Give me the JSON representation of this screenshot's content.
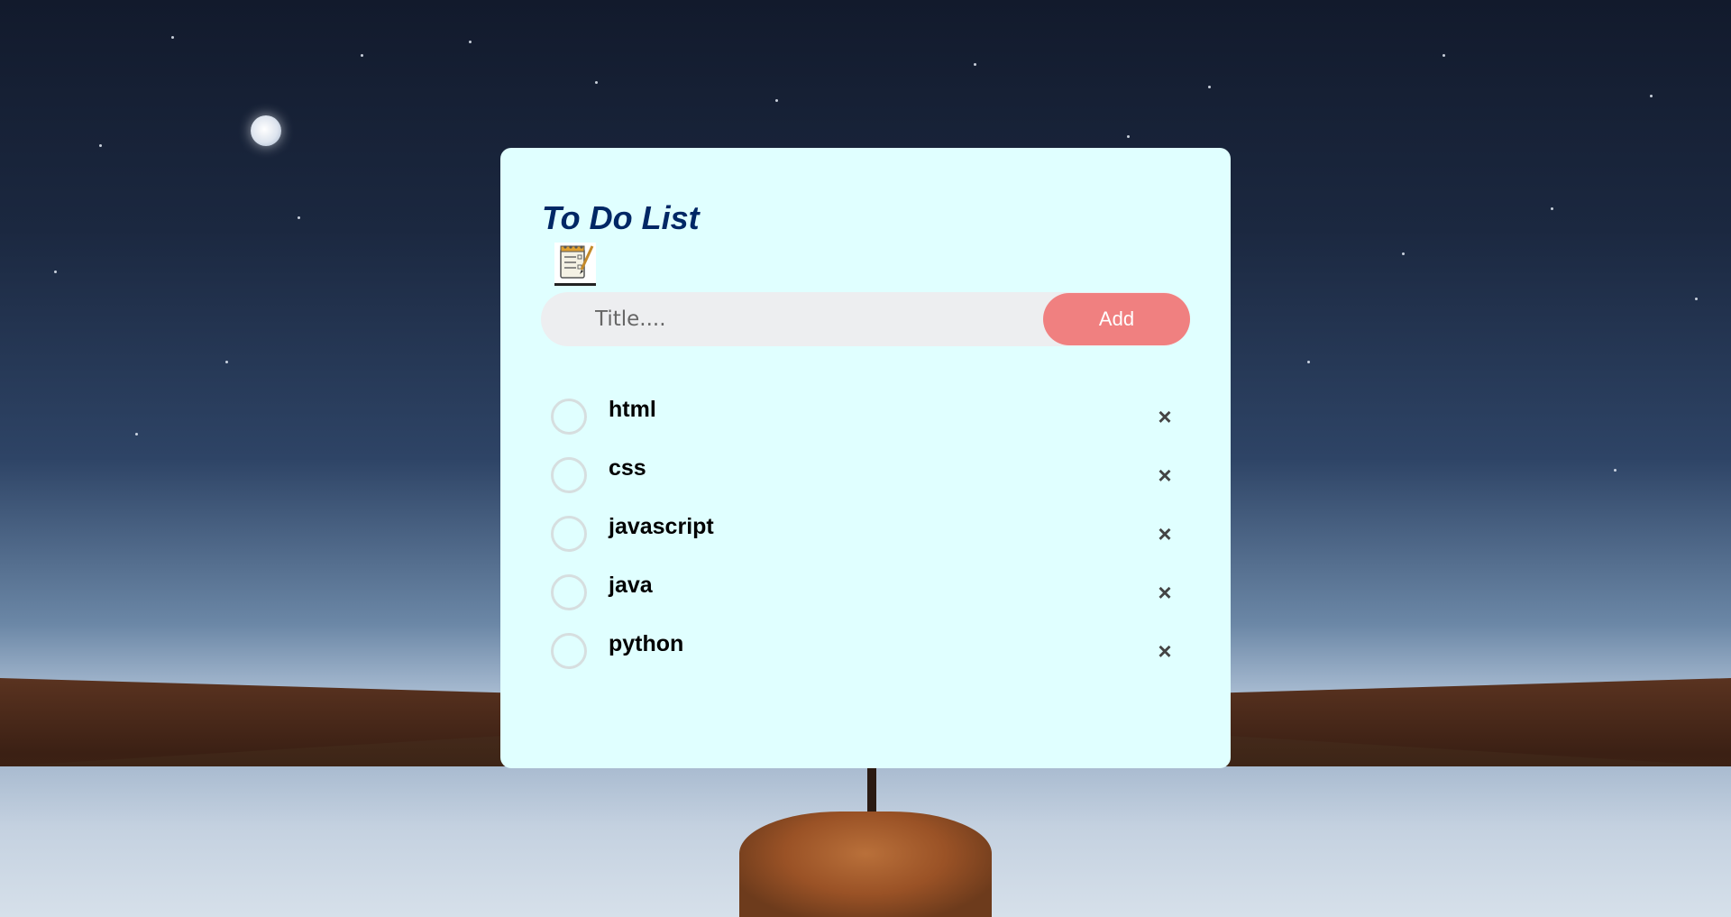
{
  "app": {
    "title": "To Do List"
  },
  "input": {
    "placeholder": "Title....",
    "value": ""
  },
  "add_button": {
    "label": "Add"
  },
  "tasks": [
    {
      "label": "html",
      "checked": false
    },
    {
      "label": "css",
      "checked": false
    },
    {
      "label": "javascript",
      "checked": false
    },
    {
      "label": "java",
      "checked": false
    },
    {
      "label": "python",
      "checked": false
    }
  ],
  "icons": {
    "title_icon": "notepad-icon",
    "delete_icon": "close-icon",
    "check_icon": "circle-checkbox"
  },
  "colors": {
    "card_background": "#e0ffff",
    "title": "#002765",
    "add_button": "#f08080",
    "input_background": "#edeef0",
    "checkbox_border": "#d6dedf"
  }
}
